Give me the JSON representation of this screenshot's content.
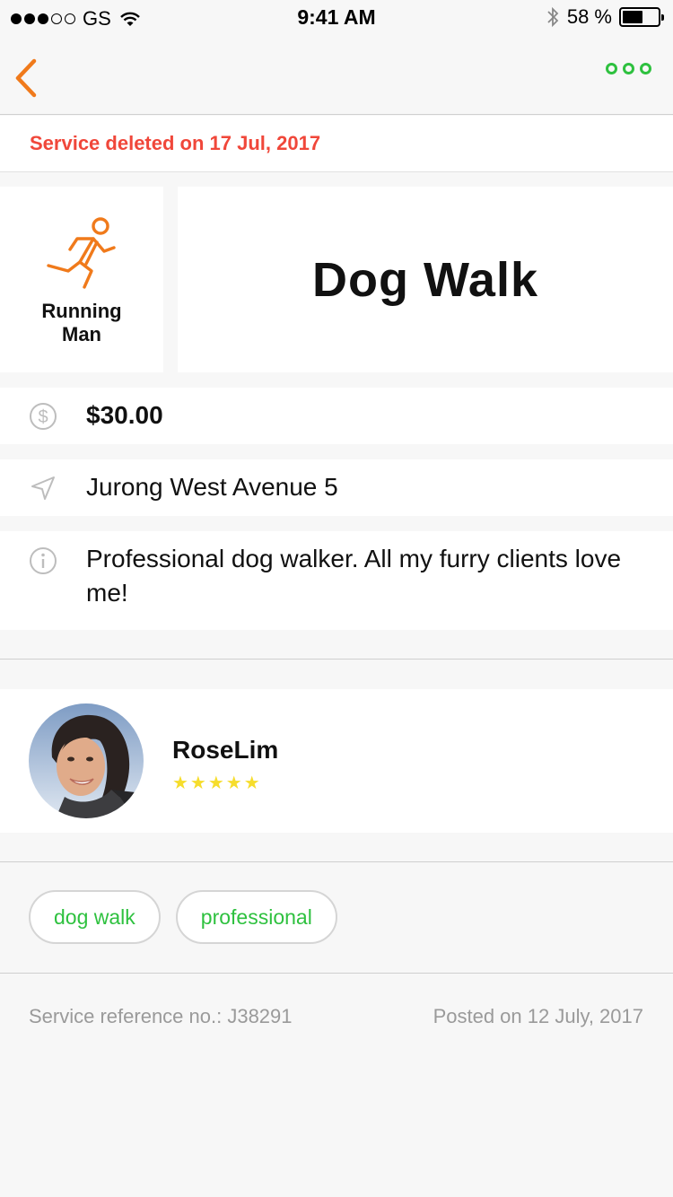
{
  "status_bar": {
    "carrier": "GS",
    "time": "9:41 AM",
    "battery": "58 %",
    "battery_level": 0.58,
    "signal_strength": 3,
    "signal_max": 5
  },
  "nav": {
    "back_icon": "chevron-left-icon",
    "more_icon": "more-dots-icon",
    "accent_color": "#f07a1b",
    "action_color": "#2ec13f"
  },
  "banner": {
    "text": "Service deleted on 17 Jul, 2017",
    "color": "#f0473a"
  },
  "service": {
    "category_icon": "running-man-icon",
    "category_label": "Running Man",
    "title": "Dog Walk",
    "price": "$30.00",
    "price_icon": "dollar-circle-icon",
    "location": "Jurong West Avenue 5",
    "location_icon": "location-arrow-icon",
    "description": "Professional dog walker. All my furry clients love me!",
    "description_icon": "info-circle-icon"
  },
  "provider": {
    "name": "RoseLim",
    "stars": "★★★★★",
    "rating": 5,
    "rating_max": 5
  },
  "tags": [
    "dog walk",
    "professional"
  ],
  "footer": {
    "reference": "Service reference no.: J38291",
    "posted": "Posted on 12 July, 2017"
  }
}
